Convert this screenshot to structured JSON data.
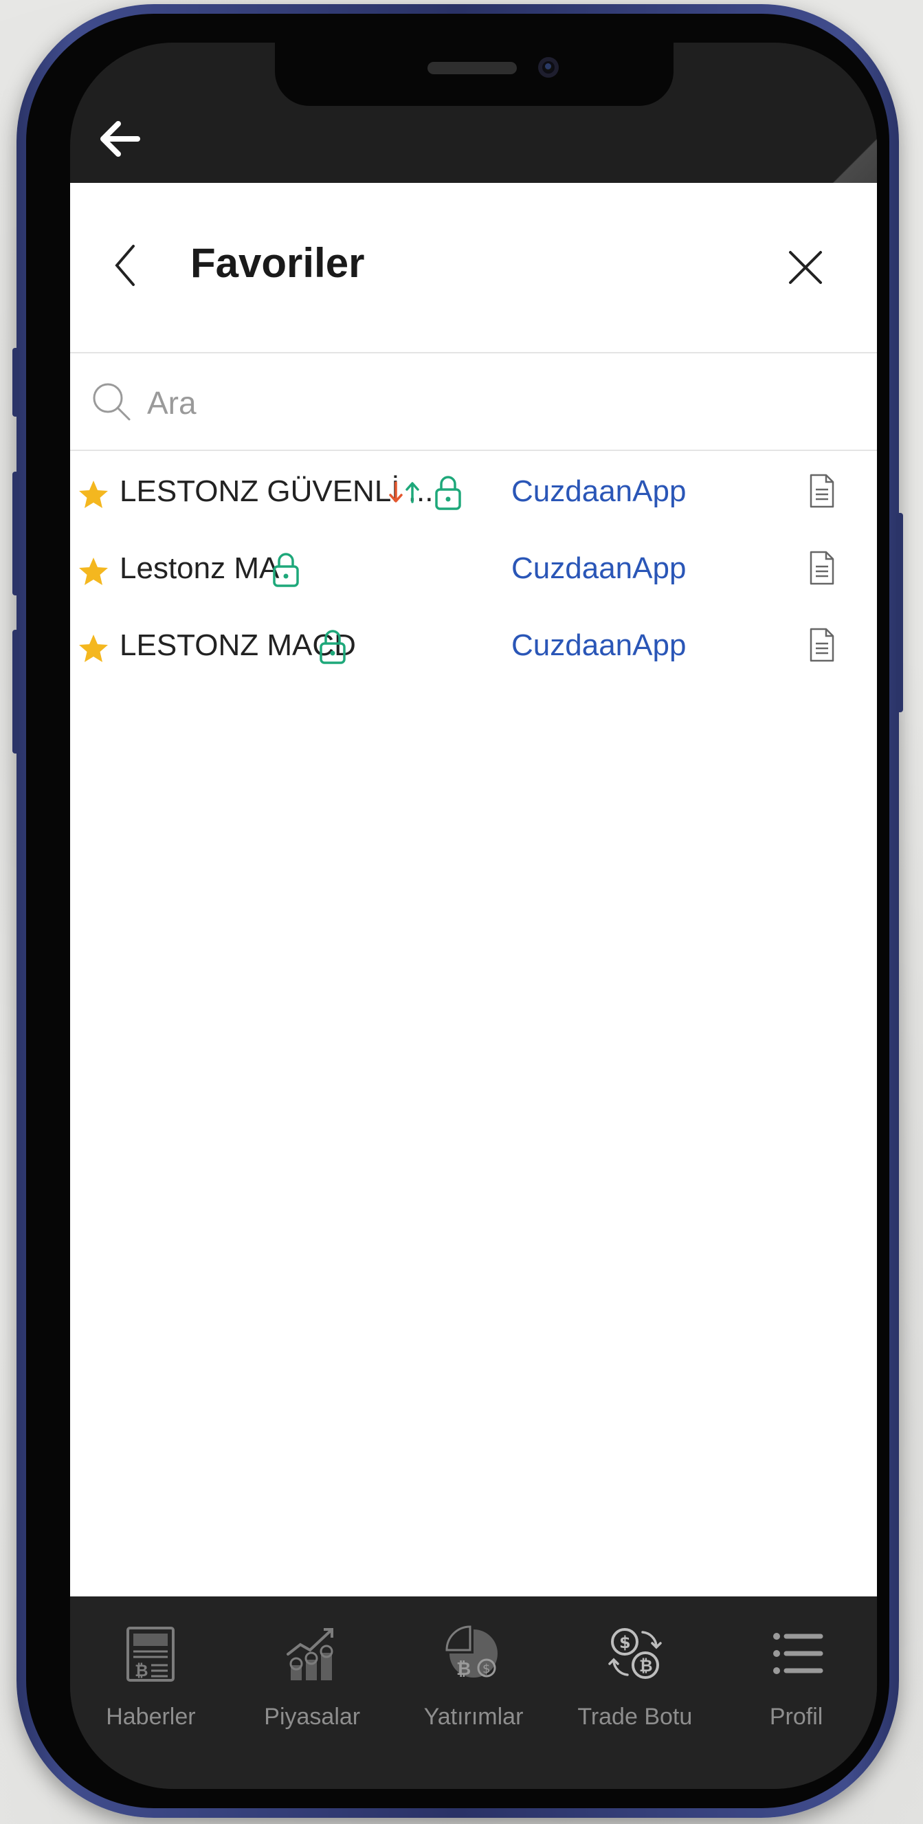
{
  "header": {
    "title": "Favoriler"
  },
  "search": {
    "placeholder": "Ara"
  },
  "favorites": [
    {
      "name": "LESTONZ GÜVENLİ ...",
      "provider": "CuzdaanApp",
      "has_arrows": true,
      "locked": true
    },
    {
      "name": "Lestonz MA",
      "provider": "CuzdaanApp",
      "has_arrows": false,
      "locked": true
    },
    {
      "name": "LESTONZ MACD",
      "provider": "CuzdaanApp",
      "has_arrows": false,
      "locked": true
    }
  ],
  "nav": [
    {
      "label": "Haberler",
      "icon": "newspaper-bitcoin-icon"
    },
    {
      "label": "Piyasalar",
      "icon": "market-growth-icon"
    },
    {
      "label": "Yatırımlar",
      "icon": "investment-chart-icon"
    },
    {
      "label": "Trade Botu",
      "icon": "exchange-coins-icon"
    },
    {
      "label": "Profil",
      "icon": "list-menu-icon"
    }
  ],
  "colors": {
    "star": "#f4b71f",
    "lock": "#1ea87a",
    "arrow_down": "#e4572e",
    "arrow_up": "#1ea87a",
    "provider_link": "#2a56b7",
    "nav_background": "#232323",
    "phone_frame": "#2b3468"
  }
}
